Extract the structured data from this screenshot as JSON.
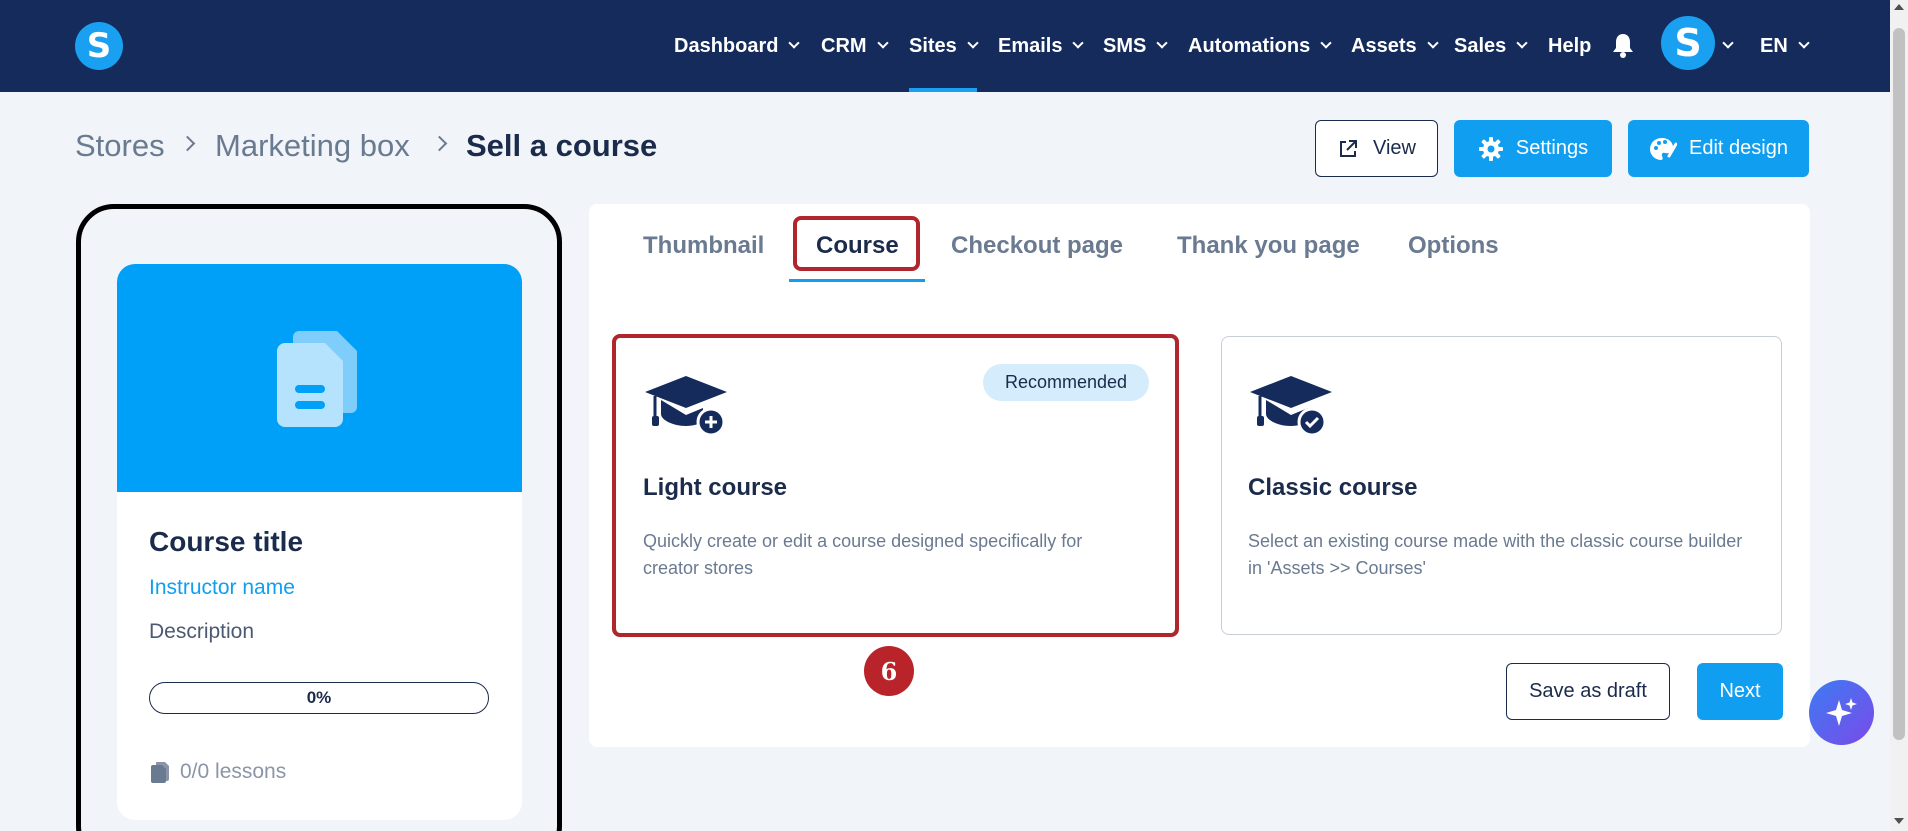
{
  "nav": {
    "items": [
      {
        "label": "Dashboard",
        "dropdown": true
      },
      {
        "label": "CRM",
        "dropdown": true
      },
      {
        "label": "Sites",
        "dropdown": true,
        "active": true
      },
      {
        "label": "Emails",
        "dropdown": true
      },
      {
        "label": "SMS",
        "dropdown": true
      },
      {
        "label": "Automations",
        "dropdown": true
      },
      {
        "label": "Assets",
        "dropdown": true
      },
      {
        "label": "Sales",
        "dropdown": true
      },
      {
        "label": "Help",
        "dropdown": false
      }
    ],
    "logo_letter": "S",
    "avatar_letter": "S",
    "language": "EN"
  },
  "breadcrumb": [
    "Stores",
    "Marketing box",
    "Sell a course"
  ],
  "header_buttons": {
    "view": "View",
    "settings": "Settings",
    "edit_design": "Edit design"
  },
  "preview": {
    "course_title": "Course title",
    "instructor": "Instructor name",
    "description": "Description",
    "progress_label": "0%",
    "progress": 0,
    "lessons": "0/0 lessons"
  },
  "tabs": [
    {
      "label": "Thumbnail"
    },
    {
      "label": "Course",
      "active": true
    },
    {
      "label": "Checkout page"
    },
    {
      "label": "Thank you page"
    },
    {
      "label": "Options"
    }
  ],
  "options": {
    "light": {
      "title": "Light course",
      "description": "Quickly create or edit a course designed specifically for creator stores",
      "badge": "Recommended"
    },
    "classic": {
      "title": "Classic course",
      "description": "Select an existing course made with the classic course builder in 'Assets >> Courses'"
    }
  },
  "footer_buttons": {
    "save_draft": "Save as draft",
    "next": "Next"
  },
  "step_marker": "6",
  "colors": {
    "nav_bg": "#142b5c",
    "primary": "#109ff0",
    "highlight": "#b0262c",
    "text_dark": "#1b2b4b",
    "text_muted": "#6a7a90"
  }
}
